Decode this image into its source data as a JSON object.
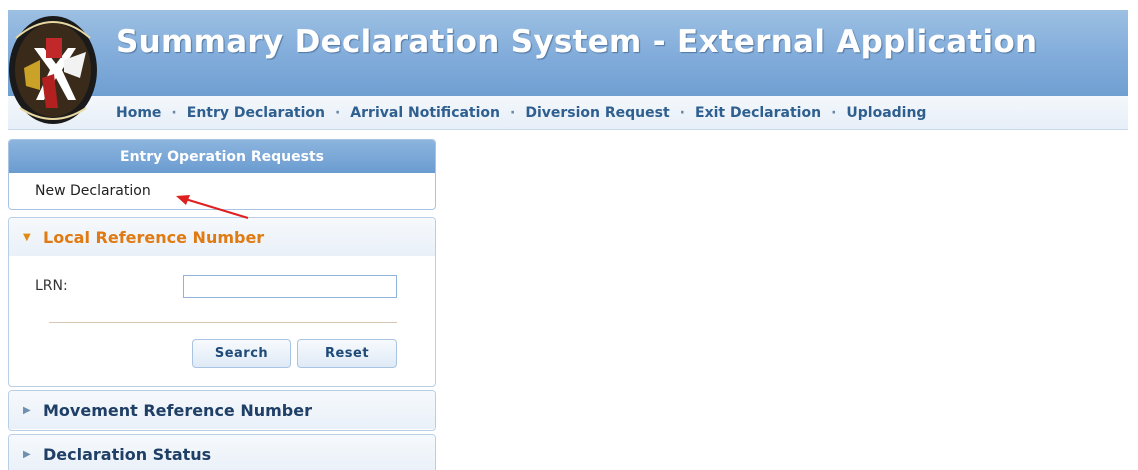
{
  "header": {
    "title": "Summary Declaration System - External Application",
    "logo_icon": "malta-customs-crest-icon"
  },
  "nav": {
    "items": [
      {
        "label": "Home"
      },
      {
        "label": "Entry Declaration"
      },
      {
        "label": "Arrival Notification"
      },
      {
        "label": "Diversion Request"
      },
      {
        "label": "Exit Declaration"
      },
      {
        "label": "Uploading"
      }
    ],
    "separator": "·"
  },
  "requests_panel": {
    "title": "Entry Operation Requests",
    "new_declaration_label": "New Declaration"
  },
  "accordion": {
    "lrn": {
      "title": "Local Reference Number",
      "field_label": "LRN:",
      "field_value": "",
      "search_label": "Search",
      "reset_label": "Reset",
      "expanded": true
    },
    "mrn": {
      "title": "Movement Reference Number",
      "expanded": false
    },
    "status": {
      "title": "Declaration Status",
      "expanded": false
    }
  },
  "colors": {
    "header_blue": "#83addb",
    "nav_link": "#2f5f8f",
    "active_accent": "#e07a12",
    "annotation_arrow": "#e02020"
  }
}
